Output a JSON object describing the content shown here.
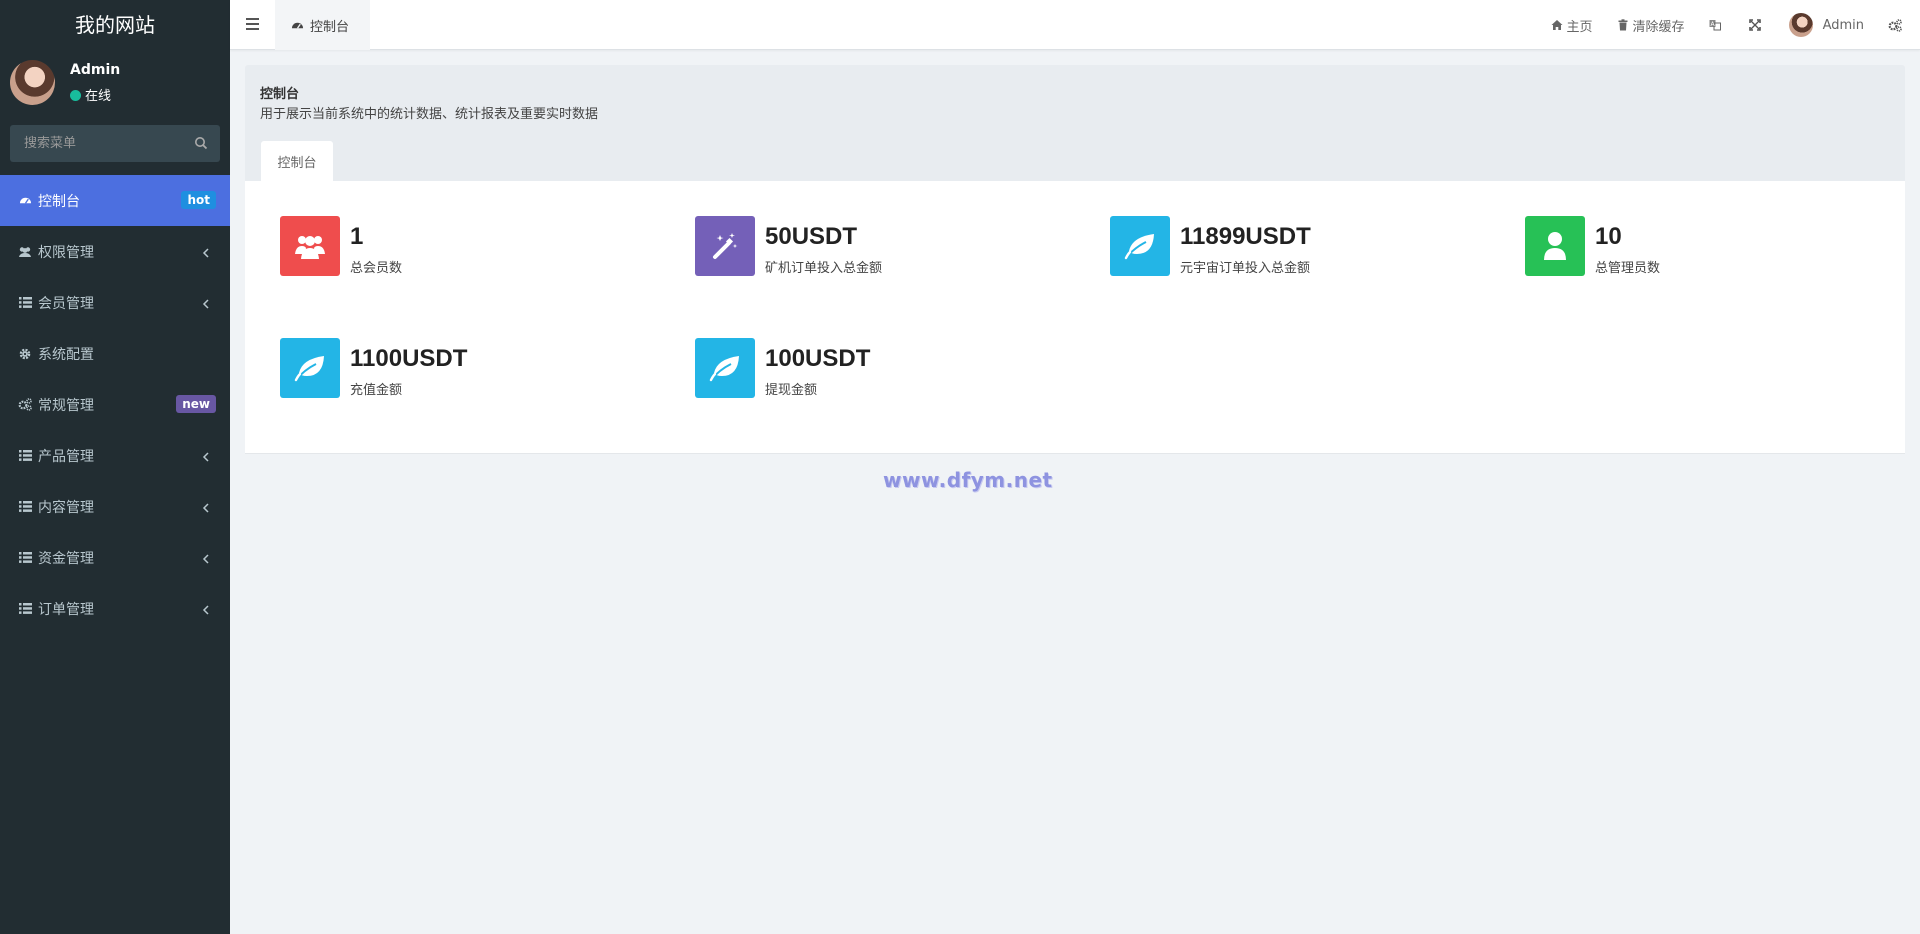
{
  "sidebar": {
    "logo": "我的网站",
    "user": {
      "name": "Admin",
      "status": "在线"
    },
    "search": {
      "placeholder": "搜索菜单"
    },
    "items": [
      {
        "label": "控制台",
        "icon": "dashboard-icon",
        "badge": "hot",
        "active": true
      },
      {
        "label": "权限管理",
        "icon": "users-icon",
        "expandable": true
      },
      {
        "label": "会员管理",
        "icon": "list-icon",
        "expandable": true
      },
      {
        "label": "系统配置",
        "icon": "gear-icon"
      },
      {
        "label": "常规管理",
        "icon": "cogs-icon",
        "badge": "new"
      },
      {
        "label": "产品管理",
        "icon": "list-icon",
        "expandable": true
      },
      {
        "label": "内容管理",
        "icon": "list-icon",
        "expandable": true
      },
      {
        "label": "资金管理",
        "icon": "list-icon",
        "expandable": true
      },
      {
        "label": "订单管理",
        "icon": "list-icon",
        "expandable": true
      }
    ]
  },
  "header": {
    "tab": "控制台",
    "home": "主页",
    "clear_cache": "清除缓存",
    "admin": "Admin"
  },
  "content": {
    "title": "控制台",
    "subtitle": "用于展示当前系统中的统计数据、统计报表及重要实时数据",
    "tab": "控制台"
  },
  "stats": [
    {
      "value": "1",
      "label": "总会员数",
      "color": "#ef4d4d",
      "icon": "users-icon"
    },
    {
      "value": "50USDT",
      "label": "矿机订单投入总金额",
      "color": "#7460b8",
      "icon": "magic-wand-icon"
    },
    {
      "value": "11899USDT",
      "label": "元宇宙订单投入总金额",
      "color": "#23b5e6",
      "icon": "leaf-icon"
    },
    {
      "value": "10",
      "label": "总管理员数",
      "color": "#27c156",
      "icon": "user-icon"
    },
    {
      "value": "1100USDT",
      "label": "充值金额",
      "color": "#23b5e6",
      "icon": "leaf-icon"
    },
    {
      "value": "100USDT",
      "label": "提现金额",
      "color": "#23b5e6",
      "icon": "leaf-icon"
    }
  ],
  "watermark": "www.dfym.net"
}
